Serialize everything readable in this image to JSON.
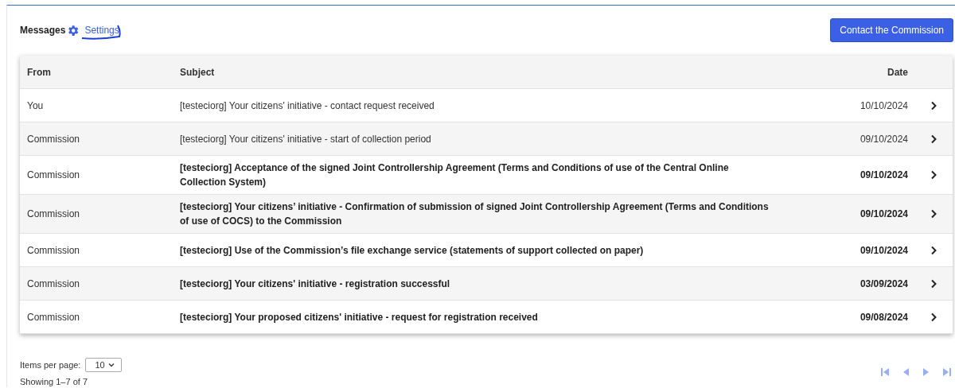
{
  "header": {
    "title": "Messages",
    "settings_link": "Settings",
    "contact_button": "Contact the Commission"
  },
  "table": {
    "columns": [
      "From",
      "Subject",
      "Date"
    ],
    "rows": [
      {
        "from": "You",
        "subject": "[testeciorg] Your citizens' initiative - contact request received",
        "date": "10/10/2024",
        "unread": false
      },
      {
        "from": "Commission",
        "subject": "[testeciorg] Your citizens' initiative - start of collection period",
        "date": "09/10/2024",
        "unread": false
      },
      {
        "from": "Commission",
        "subject": "[testeciorg] Acceptance of the signed Joint Controllership Agreement (Terms and Conditions of use of the Central Online Collection System)",
        "date": "09/10/2024",
        "unread": true
      },
      {
        "from": "Commission",
        "subject": "[testeciorg] Your citizens’ initiative - Confirmation of submission of signed Joint Controllership Agreement (Terms and Conditions of use of COCS) to the Commission",
        "date": "09/10/2024",
        "unread": true
      },
      {
        "from": "Commission",
        "subject": "[testeciorg] Use of the Commission’s file exchange service (statements of support collected on paper)",
        "date": "09/10/2024",
        "unread": true
      },
      {
        "from": "Commission",
        "subject": "[testeciorg] Your citizens' initiative - registration successful",
        "date": "03/09/2024",
        "unread": true
      },
      {
        "from": "Commission",
        "subject": "[testeciorg] Your proposed citizens' initiative - request for registration received",
        "date": "09/08/2024",
        "unread": true
      }
    ]
  },
  "pagination": {
    "items_per_page_label": "Items per page:",
    "page_size": "10",
    "range": "Showing 1–7 of 7"
  }
}
